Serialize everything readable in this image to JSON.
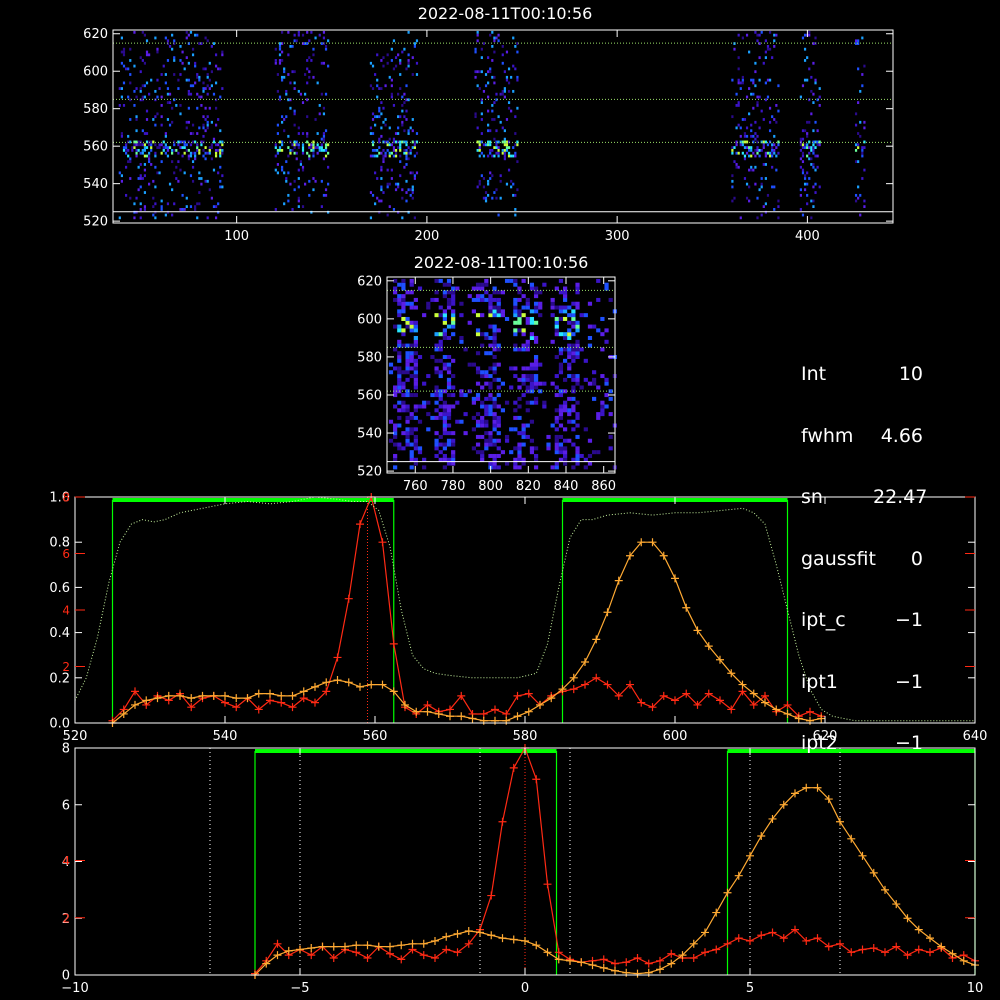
{
  "colors": {
    "background": "#000000",
    "axis": "#ffffff",
    "line1": "#ff2a14",
    "line2": "#ffaa33",
    "band_box": "#00ff00",
    "transmission": "#c8f5a0",
    "guide": "#9be26a",
    "tick_red": "#ff2a14"
  },
  "top_image": {
    "title": "2022-08-11T00:10:56",
    "x_ticks": [
      "100",
      "200",
      "300",
      "400"
    ],
    "y_ticks": [
      "520",
      "540",
      "560",
      "580",
      "600",
      "620"
    ],
    "xlim": [
      35,
      445
    ],
    "ylim": [
      519,
      622
    ],
    "guides_y": [
      525,
      562,
      585,
      615
    ]
  },
  "small_image": {
    "title": "2022-08-11T00:10:56",
    "x_ticks": [
      "760",
      "780",
      "800",
      "820",
      "840",
      "860"
    ],
    "y_ticks": [
      "520",
      "540",
      "560",
      "580",
      "600",
      "620"
    ],
    "xlim": [
      745,
      866
    ],
    "ylim": [
      519,
      622
    ],
    "guides_y": [
      525,
      562,
      585,
      615
    ]
  },
  "params": [
    {
      "label": "Int",
      "value": "10"
    },
    {
      "label": "fwhm",
      "value": "4.66"
    },
    {
      "label": "sn",
      "value": "22.47"
    },
    {
      "label": "gaussfit",
      "value": "0"
    },
    {
      "label": "ipt_c",
      "value": "−1"
    },
    {
      "label": "ipt1",
      "value": "−1"
    },
    {
      "label": "ipt2",
      "value": "−1"
    }
  ],
  "chart_data": [
    {
      "type": "line",
      "xlim": [
        520,
        640
      ],
      "ylim": [
        0,
        1.0
      ],
      "x_ticks": [
        "520",
        "540",
        "560",
        "580",
        "600",
        "620",
        "640"
      ],
      "y_ticks": [
        "0.0",
        "0.2",
        "0.4",
        "0.6",
        "0.8",
        "1.0"
      ],
      "y_ticks_red": [
        "2",
        "4",
        "6",
        "8"
      ],
      "bands": [
        [
          525,
          562.5
        ],
        [
          585,
          615
        ]
      ],
      "vline": 559,
      "series": [
        {
          "x": [
            525,
            526.5,
            528,
            529.5,
            531,
            532.5,
            534,
            535.5,
            537,
            538.5,
            540,
            541.5,
            543,
            544.5,
            546,
            547.5,
            549,
            550.5,
            552,
            553.5,
            555,
            556.5,
            558,
            559.5,
            561,
            562.5,
            564,
            565.5,
            567,
            568.5,
            570,
            571.5,
            573,
            574.5,
            576,
            577.5,
            579,
            580.5,
            582,
            583.5,
            585,
            586.5,
            588,
            589.5,
            591,
            592.5,
            594,
            595.5,
            597,
            598.5,
            600,
            601.5,
            603,
            604.5,
            606,
            607.5,
            609,
            610.5,
            612,
            613.5,
            615,
            616.5,
            618,
            619.5
          ],
          "values": [
            0.01,
            0.06,
            0.14,
            0.08,
            0.12,
            0.1,
            0.13,
            0.07,
            0.11,
            0.12,
            0.09,
            0.07,
            0.11,
            0.06,
            0.1,
            0.09,
            0.07,
            0.11,
            0.09,
            0.14,
            0.29,
            0.55,
            0.88,
            1.0,
            0.8,
            0.35,
            0.07,
            0.04,
            0.08,
            0.05,
            0.06,
            0.12,
            0.04,
            0.04,
            0.06,
            0.04,
            0.12,
            0.13,
            0.08,
            0.12,
            0.14,
            0.15,
            0.17,
            0.2,
            0.17,
            0.12,
            0.17,
            0.09,
            0.07,
            0.12,
            0.1,
            0.13,
            0.08,
            0.13,
            0.1,
            0.06,
            0.14,
            0.08,
            0.12,
            0.05,
            0.08,
            0.03,
            0.05,
            0.03
          ]
        },
        {
          "x": [
            525,
            526.5,
            528,
            529.5,
            531,
            532.5,
            534,
            535.5,
            537,
            538.5,
            540,
            541.5,
            543,
            544.5,
            546,
            547.5,
            549,
            550.5,
            552,
            553.5,
            555,
            556.5,
            558,
            559.5,
            561,
            562.5,
            564,
            565.5,
            567,
            568.5,
            570,
            571.5,
            573,
            574.5,
            576,
            577.5,
            579,
            580.5,
            582,
            583.5,
            585,
            586.5,
            588,
            589.5,
            591,
            592.5,
            594,
            595.5,
            597,
            598.5,
            600,
            601.5,
            603,
            604.5,
            606,
            607.5,
            609,
            610.5,
            612,
            613.5,
            615,
            616.5,
            618,
            619.5
          ],
          "values": [
            0.0,
            0.04,
            0.08,
            0.1,
            0.11,
            0.12,
            0.12,
            0.11,
            0.12,
            0.12,
            0.12,
            0.11,
            0.11,
            0.13,
            0.13,
            0.12,
            0.12,
            0.14,
            0.16,
            0.18,
            0.19,
            0.18,
            0.16,
            0.17,
            0.17,
            0.14,
            0.08,
            0.05,
            0.05,
            0.04,
            0.03,
            0.03,
            0.02,
            0.01,
            0.01,
            0.01,
            0.03,
            0.05,
            0.08,
            0.11,
            0.15,
            0.2,
            0.27,
            0.37,
            0.49,
            0.63,
            0.74,
            0.8,
            0.8,
            0.74,
            0.64,
            0.51,
            0.41,
            0.34,
            0.28,
            0.22,
            0.17,
            0.13,
            0.09,
            0.06,
            0.04,
            0.02,
            0.01,
            0.02
          ]
        },
        {
          "x": [
            520,
            521.5,
            523,
            524.5,
            526,
            527.5,
            529,
            530.5,
            532,
            534,
            537,
            540,
            543,
            546,
            549,
            552,
            555,
            557,
            559,
            560.5,
            562,
            563.5,
            565,
            566.5,
            568,
            570,
            573,
            576,
            579,
            581.5,
            583,
            584.5,
            586,
            587.5,
            589,
            591,
            594,
            597,
            600,
            603,
            606,
            609,
            610.5,
            612,
            613.5,
            615,
            616.5,
            618,
            619.5,
            621,
            622.5,
            624,
            626,
            630,
            635,
            640
          ],
          "values": [
            0.1,
            0.2,
            0.38,
            0.62,
            0.8,
            0.88,
            0.9,
            0.89,
            0.9,
            0.93,
            0.95,
            0.97,
            0.98,
            0.97,
            0.98,
            1.0,
            0.99,
            0.98,
            0.98,
            0.94,
            0.78,
            0.5,
            0.3,
            0.24,
            0.22,
            0.21,
            0.2,
            0.2,
            0.2,
            0.22,
            0.35,
            0.6,
            0.82,
            0.9,
            0.9,
            0.92,
            0.93,
            0.92,
            0.93,
            0.93,
            0.94,
            0.95,
            0.93,
            0.88,
            0.7,
            0.5,
            0.3,
            0.15,
            0.06,
            0.03,
            0.02,
            0.01,
            0.01,
            0.01,
            0.01,
            0.01
          ]
        }
      ]
    },
    {
      "type": "line",
      "xlim": [
        -10,
        10
      ],
      "ylim": [
        0,
        8
      ],
      "x_ticks": [
        "−10",
        "−5",
        "0",
        "5",
        "10"
      ],
      "y_ticks": [
        "0",
        "2",
        "4",
        "6",
        "8"
      ],
      "y_ticks_red": [
        "2",
        "4"
      ],
      "bands": [
        [
          -6,
          0.7
        ],
        [
          4.5,
          10
        ]
      ],
      "vlines_dotted": [
        -7,
        -5,
        -1,
        1,
        5,
        7
      ],
      "vline": 0,
      "series": [
        {
          "x": [
            -6,
            -5.75,
            -5.5,
            -5.25,
            -5,
            -4.75,
            -4.5,
            -4.25,
            -4,
            -3.75,
            -3.5,
            -3.25,
            -3,
            -2.75,
            -2.5,
            -2.25,
            -2,
            -1.75,
            -1.5,
            -1.25,
            -1,
            -0.75,
            -0.5,
            -0.25,
            0,
            0.25,
            0.5,
            0.75,
            1,
            1.25,
            1.5,
            1.75,
            2,
            2.25,
            2.5,
            2.75,
            3,
            3.25,
            3.5,
            3.75,
            4,
            4.25,
            4.5,
            4.75,
            5,
            5.25,
            5.5,
            5.75,
            6,
            6.25,
            6.5,
            6.75,
            7,
            7.25,
            7.5,
            7.75,
            8,
            8.25,
            8.5,
            8.75,
            9,
            9.25,
            9.5,
            9.75,
            10
          ],
          "values": [
            0.05,
            0.5,
            1.1,
            0.7,
            0.9,
            0.7,
            1.0,
            0.6,
            0.9,
            0.8,
            0.6,
            1.0,
            0.75,
            0.55,
            0.9,
            0.7,
            0.6,
            0.9,
            0.8,
            1.1,
            1.6,
            2.8,
            5.4,
            7.3,
            8.0,
            6.9,
            3.2,
            0.8,
            0.55,
            0.45,
            0.5,
            0.55,
            0.4,
            0.45,
            0.6,
            0.4,
            0.5,
            0.75,
            0.6,
            0.6,
            0.8,
            0.9,
            1.1,
            1.3,
            1.2,
            1.4,
            1.5,
            1.3,
            1.6,
            1.2,
            1.3,
            1.0,
            1.1,
            0.8,
            0.9,
            0.95,
            0.8,
            1.0,
            0.7,
            0.9,
            0.8,
            0.95,
            0.6,
            0.7,
            0.5
          ]
        },
        {
          "x": [
            -6,
            -5.75,
            -5.5,
            -5.25,
            -5,
            -4.75,
            -4.5,
            -4.25,
            -4,
            -3.75,
            -3.5,
            -3.25,
            -3,
            -2.75,
            -2.5,
            -2.25,
            -2,
            -1.75,
            -1.5,
            -1.25,
            -1,
            -0.75,
            -0.5,
            -0.25,
            0,
            0.25,
            0.5,
            0.75,
            1,
            1.25,
            1.5,
            1.75,
            2,
            2.25,
            2.5,
            2.75,
            3,
            3.25,
            3.5,
            3.75,
            4,
            4.25,
            4.5,
            4.75,
            5,
            5.25,
            5.5,
            5.75,
            6,
            6.25,
            6.5,
            6.75,
            7,
            7.25,
            7.5,
            7.75,
            8,
            8.25,
            8.5,
            8.75,
            9,
            9.25,
            9.5,
            9.75,
            10
          ],
          "values": [
            0.0,
            0.4,
            0.7,
            0.85,
            0.9,
            0.95,
            1.0,
            1.0,
            1.0,
            1.05,
            1.05,
            1.0,
            1.0,
            1.05,
            1.1,
            1.1,
            1.2,
            1.35,
            1.45,
            1.55,
            1.5,
            1.4,
            1.3,
            1.25,
            1.2,
            1.05,
            0.8,
            0.55,
            0.5,
            0.45,
            0.35,
            0.25,
            0.15,
            0.08,
            0.05,
            0.08,
            0.2,
            0.4,
            0.7,
            1.1,
            1.5,
            2.2,
            2.9,
            3.5,
            4.2,
            4.9,
            5.5,
            6.0,
            6.4,
            6.6,
            6.6,
            6.2,
            5.4,
            4.8,
            4.2,
            3.6,
            3.0,
            2.5,
            2.0,
            1.6,
            1.3,
            1.0,
            0.75,
            0.5,
            0.35
          ]
        }
      ]
    }
  ]
}
